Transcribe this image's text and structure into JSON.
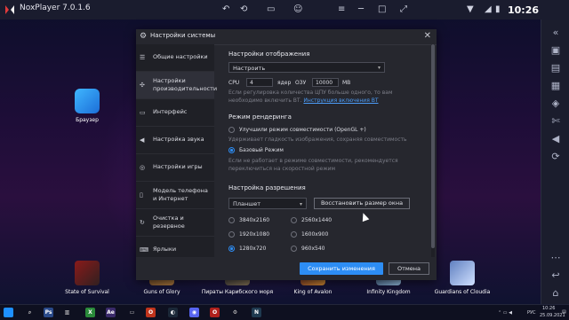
{
  "window": {
    "title": "NoxPlayer 7.0.1.6"
  },
  "status": {
    "time": "10:26"
  },
  "home": {
    "browser_label": "Браузер"
  },
  "games": [
    {
      "label": "State of Survival"
    },
    {
      "label": "Guns of Glory"
    },
    {
      "label": "Пираты Карибского моря"
    },
    {
      "label": "King of Avalon"
    },
    {
      "label": "Infinity Kingdom"
    },
    {
      "label": "Guardians of Cloudia"
    }
  ],
  "dialog": {
    "title": "Настройки системы",
    "nav": [
      {
        "label": "Общие настройки",
        "icon": "list-icon"
      },
      {
        "label": "Настройки производительности",
        "icon": "performance-icon"
      },
      {
        "label": "Интерфейс",
        "icon": "interface-icon"
      },
      {
        "label": "Настройка звука",
        "icon": "sound-icon"
      },
      {
        "label": "Настройки игры",
        "icon": "gamepad-icon"
      },
      {
        "label": "Модель телефона и Интернет",
        "icon": "phone-icon"
      },
      {
        "label": "Очистка и резервное",
        "icon": "cleanup-icon"
      },
      {
        "label": "Ярлыки",
        "icon": "shortcut-icon"
      }
    ],
    "display": {
      "title": "Настройки отображения",
      "preset": "Настроить",
      "cpu_label": "CPU",
      "cpu_value": "4",
      "cores_label": "ядер",
      "ram_label": "ОЗУ",
      "ram_value": "10000",
      "ram_unit": "MB",
      "hint_line1": "Если регулировка количества ЦПУ больше одного, то вам",
      "hint_line2": "необходимо включить ВТ.",
      "hint_link": "Инструкция включения ВТ"
    },
    "render": {
      "title": "Режим рендеринга",
      "opt1": "Улучшили режим совместимости (OpenGL +)",
      "opt1_hint": "Удерживает гладкость изображения, сохраняя совместимость",
      "opt2": "Базовый Режим",
      "opt2_hint1": "Если не работает в режиме совместимости, рекомендуется",
      "opt2_hint2": "переключиться на скоростной режим"
    },
    "resolution": {
      "title": "Настройка разрешения",
      "device": "Планшет",
      "restore_button": "Восстановить размер окна",
      "options": [
        "3840x2160",
        "2560x1440",
        "1920x1080",
        "1600x900",
        "1280x720",
        "960x540"
      ],
      "selected": "1280x720"
    },
    "save_button": "Сохранить изменения",
    "cancel_button": "Отмена"
  },
  "taskbar": {
    "clock_time": "10:26",
    "clock_date": "25.09.2021",
    "lang": "РУС"
  },
  "colors": {
    "accent": "#2d8df4",
    "dialog_bg": "#26272e",
    "nav_bg": "#1f2026"
  }
}
